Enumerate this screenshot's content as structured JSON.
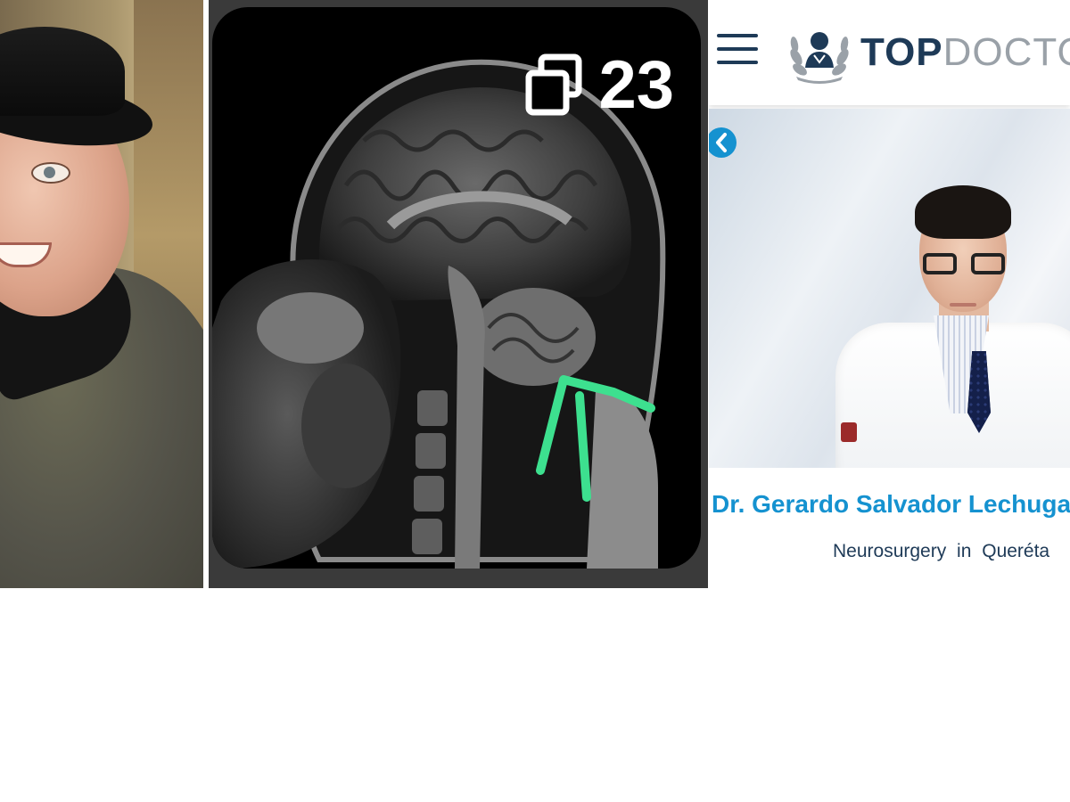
{
  "mri_panel": {
    "image_count": "23",
    "copy_icon": "stacked-squares-icon",
    "annotation_color": "#3de08f"
  },
  "topdoctors": {
    "menu_icon": "hamburger-menu-icon",
    "logo_bold": "TOP",
    "logo_light": "DOCTO",
    "carousel_prev_icon": "chevron-left-icon",
    "doctor_name": "Dr. Gerardo Salvador Lechuga",
    "specialty_line": "Neurosurgery in Queréta",
    "brand_navy": "#1e3a57",
    "brand_blue": "#1592d0"
  }
}
